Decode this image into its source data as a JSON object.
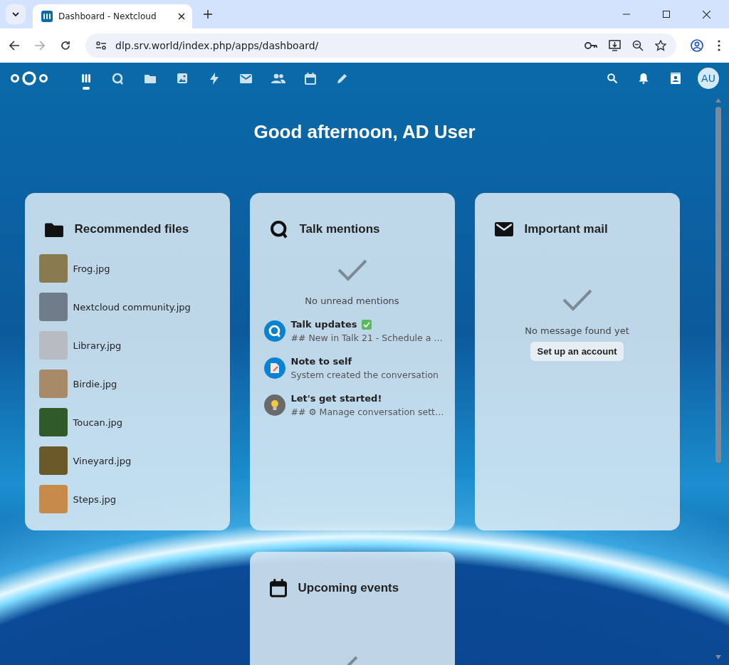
{
  "browser": {
    "tab_title": "Dashboard - Nextcloud",
    "url": "dlp.srv.world/index.php/apps/dashboard/"
  },
  "header": {
    "apps": [
      {
        "kind": "dashboard",
        "selected": true
      },
      {
        "kind": "talk",
        "selected": false
      },
      {
        "kind": "files",
        "selected": false
      },
      {
        "kind": "photos",
        "selected": false
      },
      {
        "kind": "activity",
        "selected": false
      },
      {
        "kind": "mail",
        "selected": false
      },
      {
        "kind": "contacts",
        "selected": false
      },
      {
        "kind": "calendar",
        "selected": false
      },
      {
        "kind": "notes",
        "selected": false
      }
    ],
    "avatar": "AU"
  },
  "greeting": "Good afternoon, AD User",
  "widgets": [
    {
      "kind": "files",
      "title": "Recommended files",
      "items": [
        {
          "name": "Frog.jpg",
          "color": "#8a7a50"
        },
        {
          "name": "Nextcloud community.jpg",
          "color": "#6f7c8a"
        },
        {
          "name": "Library.jpg",
          "color": "#b8bcc2"
        },
        {
          "name": "Birdie.jpg",
          "color": "#a88a68"
        },
        {
          "name": "Toucan.jpg",
          "color": "#2f5a2a"
        },
        {
          "name": "Vineyard.jpg",
          "color": "#6a5a2a"
        },
        {
          "name": "Steps.jpg",
          "color": "#c88a48"
        }
      ]
    },
    {
      "kind": "talk",
      "title": "Talk mentions",
      "empty_text": "No unread mentions",
      "conversations": [
        {
          "kind": "talk",
          "title": "Talk updates",
          "verified": true,
          "preview": "## New in Talk 21 - Schedule a …"
        },
        {
          "kind": "note",
          "title": "Note to self",
          "verified": false,
          "preview": "System created the conversation"
        },
        {
          "kind": "bulb",
          "title": "Let's get started!",
          "verified": false,
          "preview": "## ⚙ Manage conversation sett…"
        }
      ]
    },
    {
      "kind": "mail",
      "title": "Important mail",
      "empty_text": "No message found yet",
      "button": "Set up an account"
    },
    {
      "kind": "calendar",
      "title": "Upcoming events"
    }
  ]
}
